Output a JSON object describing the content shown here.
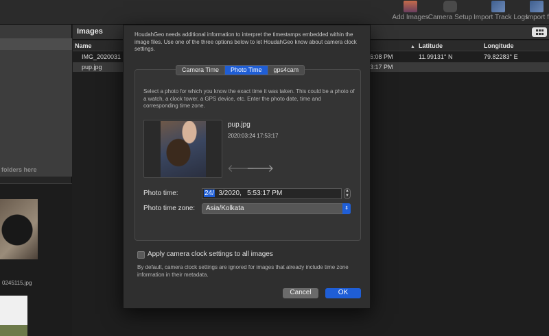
{
  "toolbar": {
    "add_images": "Add Images",
    "camera_setup": "Camera Setup",
    "import_track_logs": "Import Track Logs",
    "import_partial": "Import f"
  },
  "left_panel": {
    "folders_hint": "folders here",
    "thumb_label": "0245115.jpg"
  },
  "images_panel": {
    "title": "Images",
    "columns": {
      "name": "Name",
      "latitude": "Latitude",
      "longitude": "Longitude"
    },
    "rows": [
      {
        "name": "IMG_2020031",
        "time": "6:08 PM",
        "latitude": "11.99131° N",
        "longitude": "79.82283° E"
      },
      {
        "name": "pup.jpg",
        "time": "3:17 PM",
        "latitude": "",
        "longitude": ""
      }
    ]
  },
  "dialog": {
    "intro": "HoudahGeo needs additional information to interpret the timestamps embedded within the image files. Use one of the three options below to let HoudahGeo know about camera clock settings.",
    "tabs": [
      {
        "label": "Camera Time",
        "active": false
      },
      {
        "label": "Photo Time",
        "active": true
      },
      {
        "label": "gps4cam",
        "active": false
      }
    ],
    "help": "Select a photo for which you know the exact time it was taken. This could be a photo of a watch, a clock tower, a GPS device, etc. Enter the photo date, time and corresponding time zone.",
    "photo": {
      "name": "pup.jpg",
      "date": "2020:03:24 17:53:17"
    },
    "photo_time": {
      "label": "Photo time:",
      "day": "24/",
      "rest": "  3/2020,   5:53:17 PM"
    },
    "time_zone": {
      "label": "Photo time zone:",
      "value": "Asia/Kolkata"
    },
    "apply_all": {
      "label": "Apply camera clock settings to all images",
      "checked": false
    },
    "note": "By default, camera clock settings are ignored for images that already include time zone information in their metadata.",
    "cancel": "Cancel",
    "ok": "OK"
  },
  "icons": {
    "prev": "arrow-left-icon",
    "next": "arrow-right-icon",
    "stepper": "stepper-icon",
    "chevron": "chevron-updown-icon",
    "sort": "sort-ascending-icon",
    "grid": "grid-view-icon"
  },
  "colors": {
    "accent": "#1f5ed6",
    "panel": "#2f2f2f",
    "background": "#1e1e1e"
  }
}
